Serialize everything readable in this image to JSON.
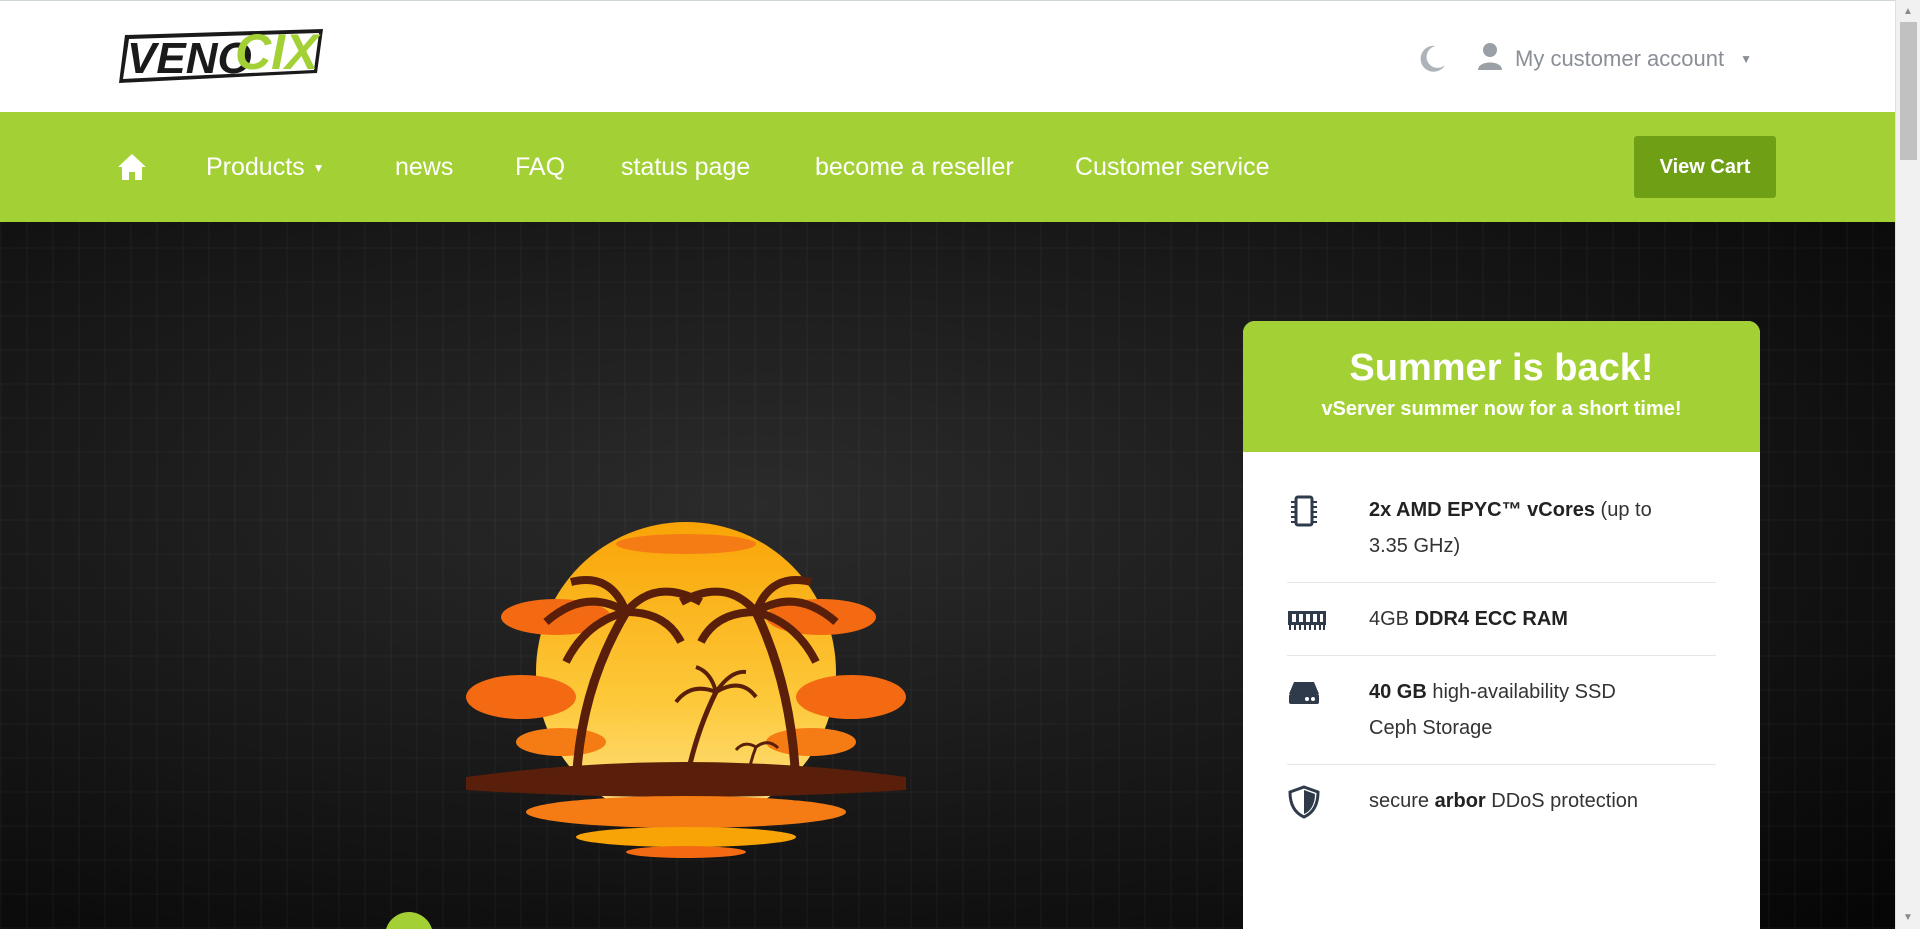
{
  "brand": {
    "logo_text_dark": "VENO",
    "logo_text_green": "CIX"
  },
  "header": {
    "theme_toggle_icon": "moon-icon",
    "account_icon": "user-icon",
    "account_label": "My customer account"
  },
  "nav": {
    "home_icon": "home-icon",
    "items": [
      {
        "label": "Products",
        "has_dropdown": true
      },
      {
        "label": "news"
      },
      {
        "label": "FAQ"
      },
      {
        "label": "status page"
      },
      {
        "label": "become a reseller"
      },
      {
        "label": "Customer service"
      }
    ],
    "cart_label": "View Cart"
  },
  "promo": {
    "title": "Summer is back!",
    "subtitle": "vServer summer now for a short time!",
    "features": [
      {
        "icon": "cpu-chip-icon",
        "bold": "2x AMD EPYC™ vCores",
        "text": " (up to 3.35 GHz)",
        "lead": ""
      },
      {
        "icon": "ram-memory-icon",
        "lead": "4GB ",
        "bold": "DDR4 ECC RAM",
        "text": ""
      },
      {
        "icon": "hard-drive-icon",
        "lead": "",
        "bold": "40 GB",
        "text": " high-availability SSD Ceph Storage"
      },
      {
        "icon": "shield-icon",
        "lead": "secure ",
        "bold": "arbor",
        "text": " DDoS protection"
      }
    ]
  },
  "colors": {
    "accent": "#a3d135",
    "accent_dark": "#6f9f15",
    "hero_bg": "#111111"
  }
}
